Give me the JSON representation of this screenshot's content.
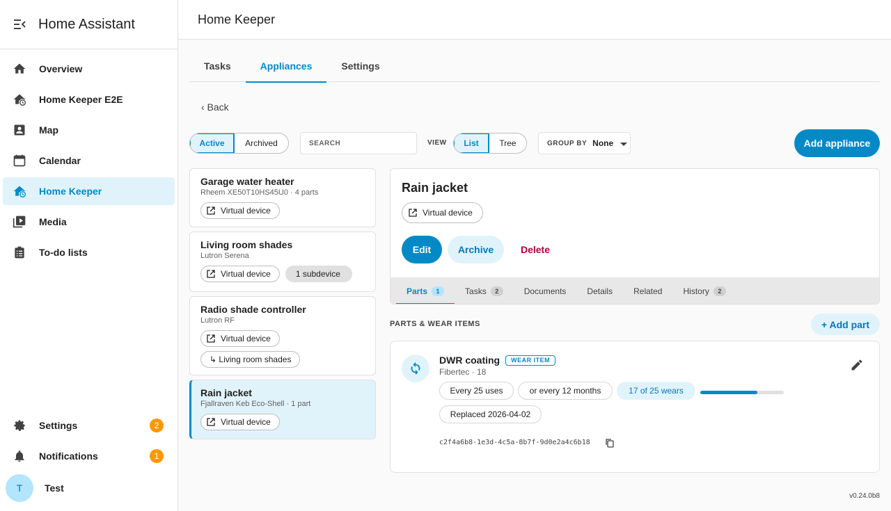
{
  "app": {
    "title": "Home Assistant"
  },
  "sidebar": {
    "items": [
      {
        "label": "Overview",
        "icon": "home-icon"
      },
      {
        "label": "Home Keeper E2E",
        "icon": "home-clock-icon"
      },
      {
        "label": "Map",
        "icon": "account-box-icon"
      },
      {
        "label": "Calendar",
        "icon": "calendar-icon"
      },
      {
        "label": "Home Keeper",
        "icon": "home-clock-icon"
      },
      {
        "label": "Media",
        "icon": "play-box-multiple-icon"
      },
      {
        "label": "To-do lists",
        "icon": "clipboard-list-icon"
      }
    ],
    "settings": {
      "label": "Settings",
      "badge": "2"
    },
    "notifications": {
      "label": "Notifications",
      "badge": "1"
    },
    "user": {
      "initial": "T",
      "name": "Test"
    }
  },
  "topbar": {
    "title": "Home Keeper"
  },
  "tabs": [
    "Tasks",
    "Appliances",
    "Settings"
  ],
  "back_label": "‹ Back",
  "filter": {
    "active": "Active",
    "archived": "Archived"
  },
  "search": {
    "placeholder": "SEARCH"
  },
  "view": {
    "label": "VIEW",
    "list": "List",
    "tree": "Tree"
  },
  "groupby": {
    "label": "GROUP BY",
    "value": "None"
  },
  "add_appliance": "Add appliance",
  "appliances": [
    {
      "name": "Garage water heater",
      "sub": "Rheem XE50T10HS45U0 · 4 parts",
      "chip": "Virtual device"
    },
    {
      "name": "Living room shades",
      "sub": "Lutron Serena",
      "chip": "Virtual device",
      "chip2": "1 subdevice"
    },
    {
      "name": "Radio shade controller",
      "sub": "Lutron RF",
      "chip": "Virtual device",
      "chip2": "↳ Living room shades"
    },
    {
      "name": "Rain jacket",
      "sub": "Fjallraven Keb Eco-Shell · 1 part",
      "chip": "Virtual device"
    }
  ],
  "detail": {
    "title": "Rain jacket",
    "chip": "Virtual device",
    "edit": "Edit",
    "archive": "Archive",
    "delete": "Delete",
    "tabs": [
      {
        "label": "Parts",
        "count": "1"
      },
      {
        "label": "Tasks",
        "count": "2"
      },
      {
        "label": "Documents"
      },
      {
        "label": "Details"
      },
      {
        "label": "Related"
      },
      {
        "label": "History",
        "count": "2"
      }
    ]
  },
  "parts": {
    "header": "PARTS & WEAR ITEMS",
    "add_label": "+ Add part",
    "item": {
      "name": "DWR coating",
      "tag": "WEAR ITEM",
      "sub": "Fibertec · 18",
      "pill_uses": "Every 25 uses",
      "pill_months": "or every 12 months",
      "pill_wears": "17 of 25 wears",
      "progress": 0.68,
      "replaced": "Replaced 2026-04-02",
      "uuid": "c2f4a6b8-1e3d-4c5a-8b7f-9d0e2a4c6b18"
    }
  },
  "version": "v0.24.0b8",
  "colors": {
    "accent": "#0389c5",
    "accent_light": "#e1f3fa",
    "badge": "#ff9800",
    "danger": "#b0003a"
  }
}
